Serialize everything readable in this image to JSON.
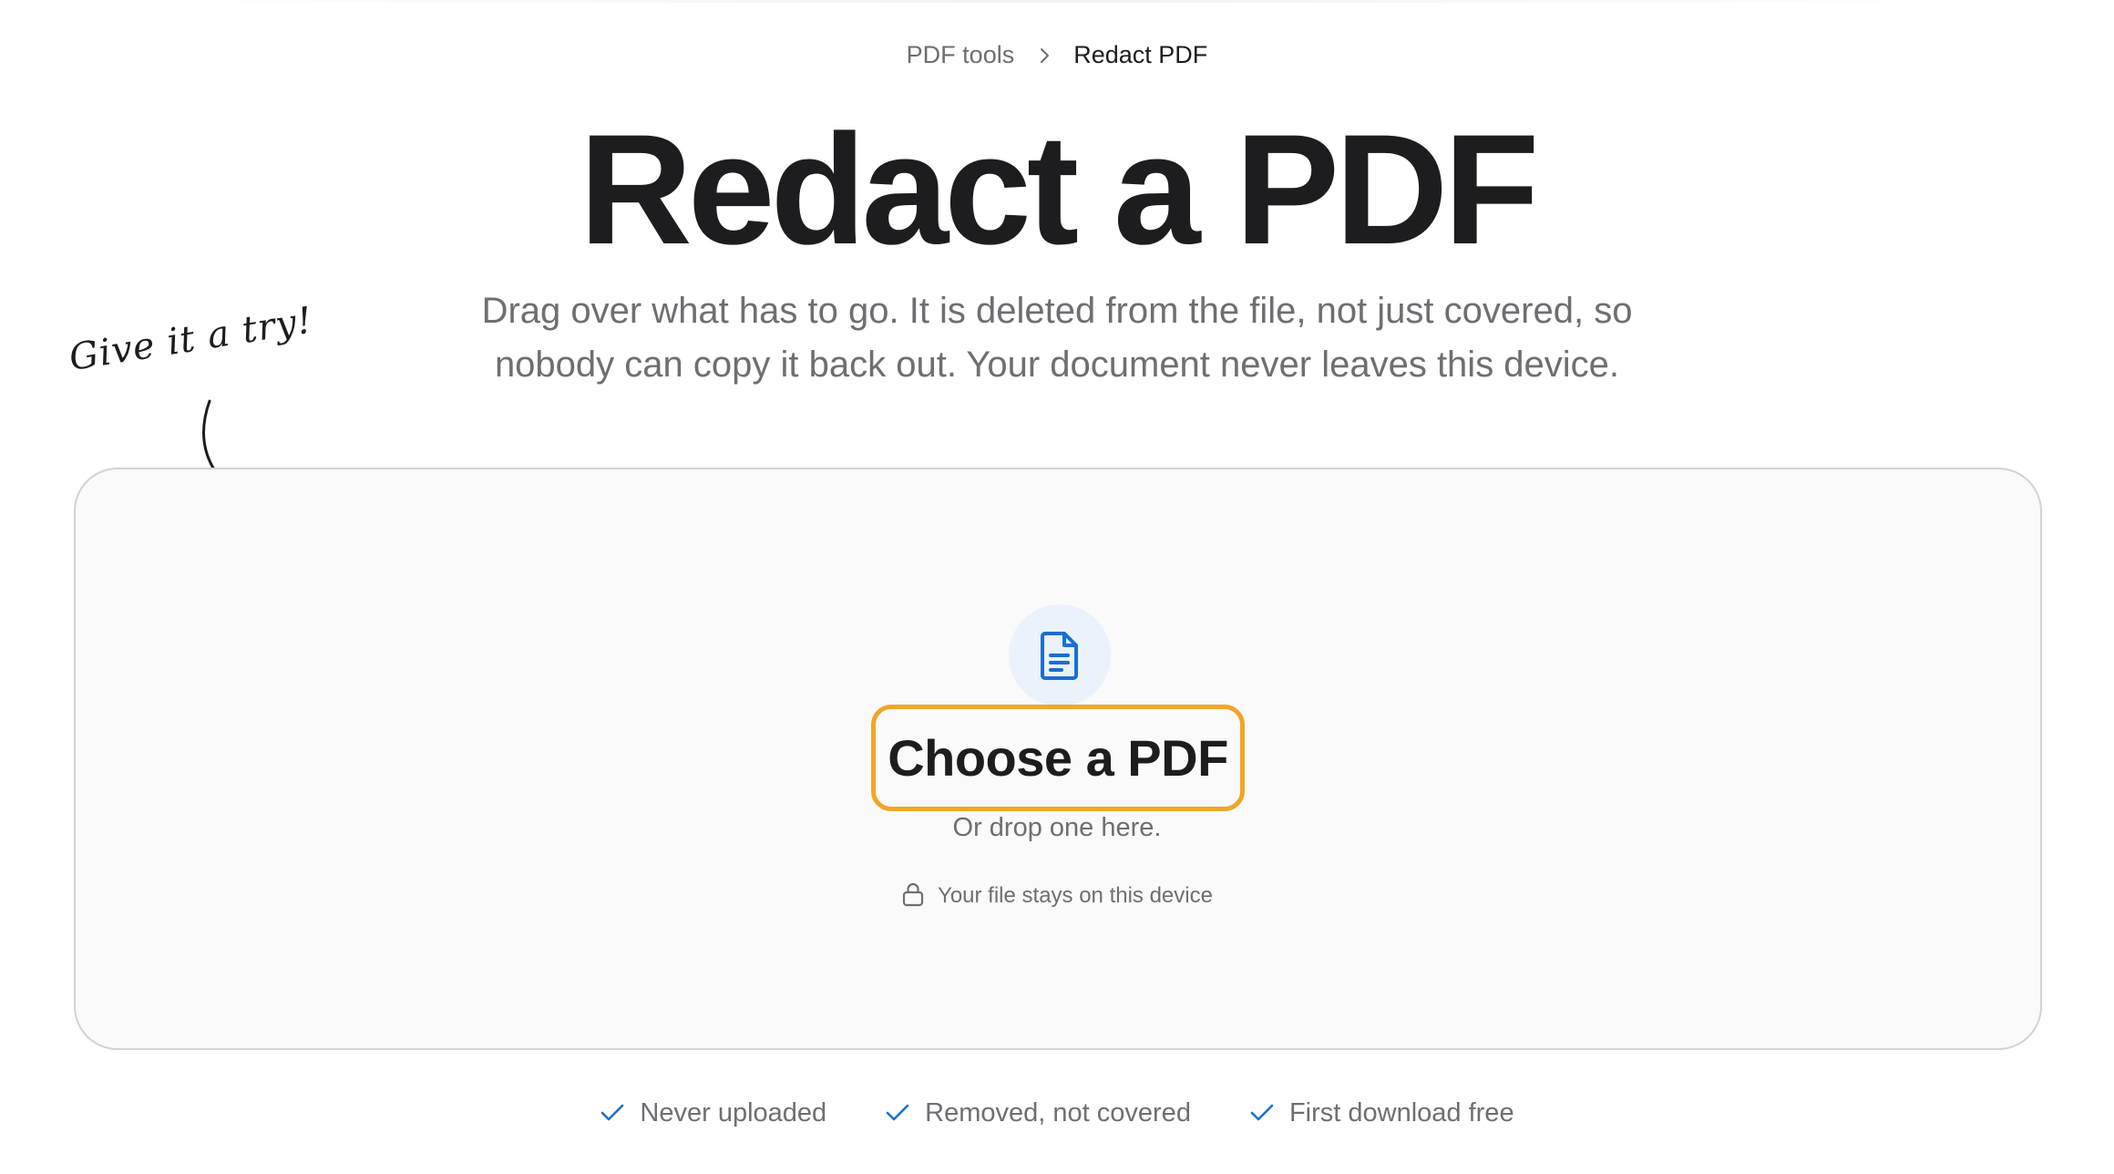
{
  "breadcrumb": {
    "parent": "PDF tools",
    "current": "Redact PDF",
    "separator_icon": "chevron-right-icon"
  },
  "title": "Redact a PDF",
  "subtitle": "Drag over what has to go. It is deleted from the file, not just covered, so nobody can copy it back out. Your document never leaves this device.",
  "hint": {
    "text": "Give it a try!",
    "icon": "curved-arrow-icon"
  },
  "dropzone": {
    "icon": "document-icon",
    "button_label": "Choose a PDF",
    "drop_hint": "Or drop one here.",
    "privacy_icon": "lock-icon",
    "privacy_note": "Your file stays on this device"
  },
  "features": [
    {
      "icon": "check-icon",
      "label": "Never uploaded"
    },
    {
      "icon": "check-icon",
      "label": "Removed, not covered"
    },
    {
      "icon": "check-icon",
      "label": "First download free"
    }
  ],
  "colors": {
    "accent_blue": "#1a6fd1",
    "button_outline": "#f3a526",
    "icon_bg": "#eaf2fc",
    "text_dark": "#1d1d1f",
    "text_muted": "#6e6e73"
  }
}
